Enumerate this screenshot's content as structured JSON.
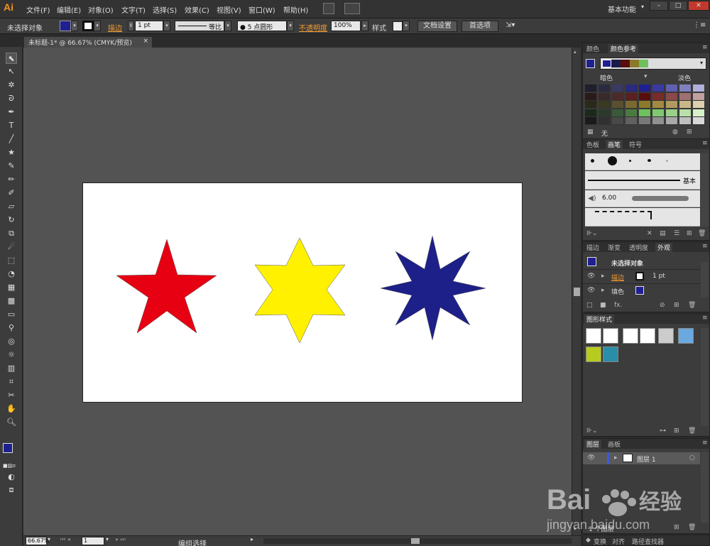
{
  "app": {
    "logo": "Ai",
    "workspace": "基本功能",
    "win_controls": [
      "–",
      "□",
      "✕"
    ]
  },
  "menu": [
    "文件(F)",
    "编辑(E)",
    "对象(O)",
    "文字(T)",
    "选择(S)",
    "效果(C)",
    "视图(V)",
    "窗口(W)",
    "帮助(H)"
  ],
  "control": {
    "selection": "未选择对象",
    "stroke_label": "描边",
    "stroke_weight": "1 pt",
    "profile": "等比",
    "brush": "5 点圆形",
    "opacity_label": "不透明度",
    "opacity": "100%",
    "style_label": "样式",
    "doc_setup": "文档设置",
    "preferences": "首选项",
    "fill_color": "#1f2090"
  },
  "doc_tab": {
    "title": "未标题-1* @ 66.67% (CMYK/预览)",
    "close": "×"
  },
  "tools": [
    "select-tool",
    "direct-select-tool",
    "magic-wand-tool",
    "lasso-tool",
    "pen-tool",
    "type-tool",
    "line-tool",
    "star-tool",
    "paintbrush-tool",
    "pencil-tool",
    "blob-brush-tool",
    "eraser-tool",
    "rotate-tool",
    "scale-tool",
    "warp-tool",
    "free-transform-tool",
    "shape-builder-tool",
    "perspective-tool",
    "mesh-tool",
    "gradient-tool",
    "eyedropper-tool",
    "blend-tool",
    "symbol-sprayer-tool",
    "graph-tool",
    "artboard-tool",
    "slice-tool",
    "hand-tool",
    "zoom-tool"
  ],
  "shapes": [
    {
      "name": "red-star",
      "color": "#e60012"
    },
    {
      "name": "yellow-star",
      "color": "#fff100"
    },
    {
      "name": "blue-star",
      "color": "#1d2088"
    }
  ],
  "status": {
    "zoom": "66.67%",
    "page": "1",
    "tool": "编组选择"
  },
  "color_guide": {
    "tabs": [
      "颜色",
      "颜色参考"
    ],
    "harmony_colors": [
      "#1f2090",
      "#1a1a4a",
      "#5a0d0d",
      "#8a7a2a",
      "#6fbf5f"
    ],
    "shade_label": "暗色",
    "tint_label": "淡色",
    "none_label": "无",
    "grid": [
      [
        "#1e1e2e",
        "#2a2a40",
        "#3a3a60",
        "#2a2a80",
        "#1f2090",
        "#3a3aa0",
        "#6060b0",
        "#8080c0",
        "#b0b0d8"
      ],
      [
        "#2a1a1a",
        "#3a2a2a",
        "#4a2a2a",
        "#5a2020",
        "#5a0d0d",
        "#7a2a2a",
        "#8a4a4a",
        "#a07070",
        "#c0a0a0"
      ],
      [
        "#2a2a1a",
        "#3a3a20",
        "#5a5030",
        "#7a6a30",
        "#8a7a2a",
        "#a08a40",
        "#b09a60",
        "#c8b888",
        "#ddd0b0"
      ],
      [
        "#1a2a1a",
        "#2a3a2a",
        "#3a5a3a",
        "#4a7a40",
        "#6fbf5f",
        "#80c870",
        "#98d088",
        "#b8e0a8",
        "#d8f0c8"
      ],
      [
        "#1a1a1a",
        "#303030",
        "#484848",
        "#606060",
        "#787878",
        "#909090",
        "#a8a8a8",
        "#c0c0c0",
        "#d8d8d8"
      ]
    ]
  },
  "brushes": {
    "tabs": [
      "色板",
      "画笔",
      "符号"
    ],
    "basic_label": "基本",
    "size": "6.00"
  },
  "appearance": {
    "tabs": [
      "描边",
      "渐变",
      "透明度",
      "外观"
    ],
    "title": "未选择对象",
    "rows": [
      {
        "label": "描边",
        "value": "1 pt"
      },
      {
        "label": "填色",
        "value": ""
      }
    ]
  },
  "graphic_styles": {
    "tabs": [
      "图形样式"
    ]
  },
  "layers": {
    "tabs": [
      "图层",
      "画板"
    ],
    "layer_name": "图层 1",
    "count": "1 个图层"
  },
  "bottom_tabs": [
    "变换",
    "对齐",
    "路径查找器"
  ]
}
